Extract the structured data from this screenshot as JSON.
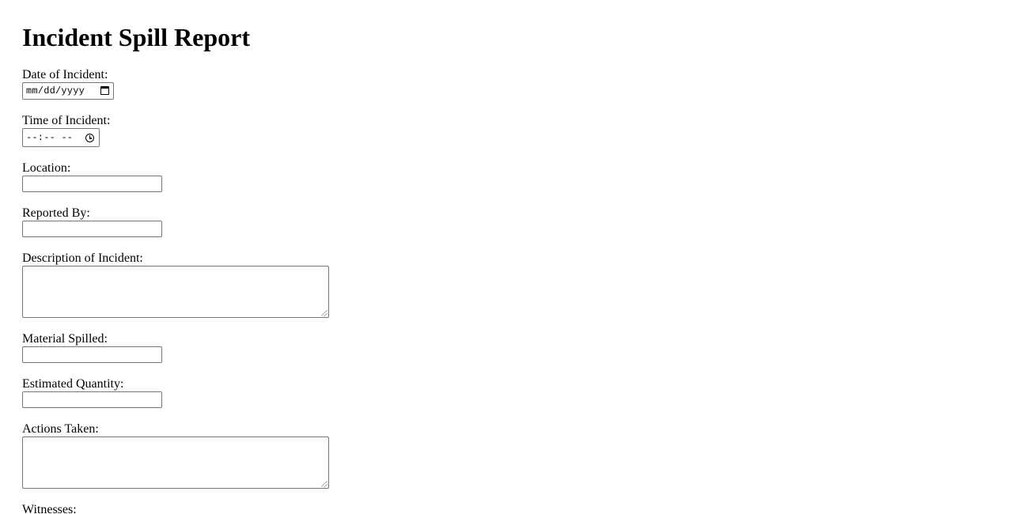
{
  "form": {
    "title": "Incident Spill Report",
    "fields": {
      "date": {
        "label": "Date of Incident:",
        "placeholder": "mm/dd/yyyy"
      },
      "time": {
        "label": "Time of Incident:",
        "placeholder": "--:-- --"
      },
      "location": {
        "label": "Location:",
        "value": ""
      },
      "reported_by": {
        "label": "Reported By:",
        "value": ""
      },
      "description": {
        "label": "Description of Incident:",
        "value": ""
      },
      "material": {
        "label": "Material Spilled:",
        "value": ""
      },
      "quantity": {
        "label": "Estimated Quantity:",
        "value": ""
      },
      "actions": {
        "label": "Actions Taken:",
        "value": ""
      },
      "witnesses": {
        "label": "Witnesses:"
      }
    }
  },
  "icons": {
    "date_picker": "calendar-icon",
    "time_picker": "clock-icon"
  }
}
